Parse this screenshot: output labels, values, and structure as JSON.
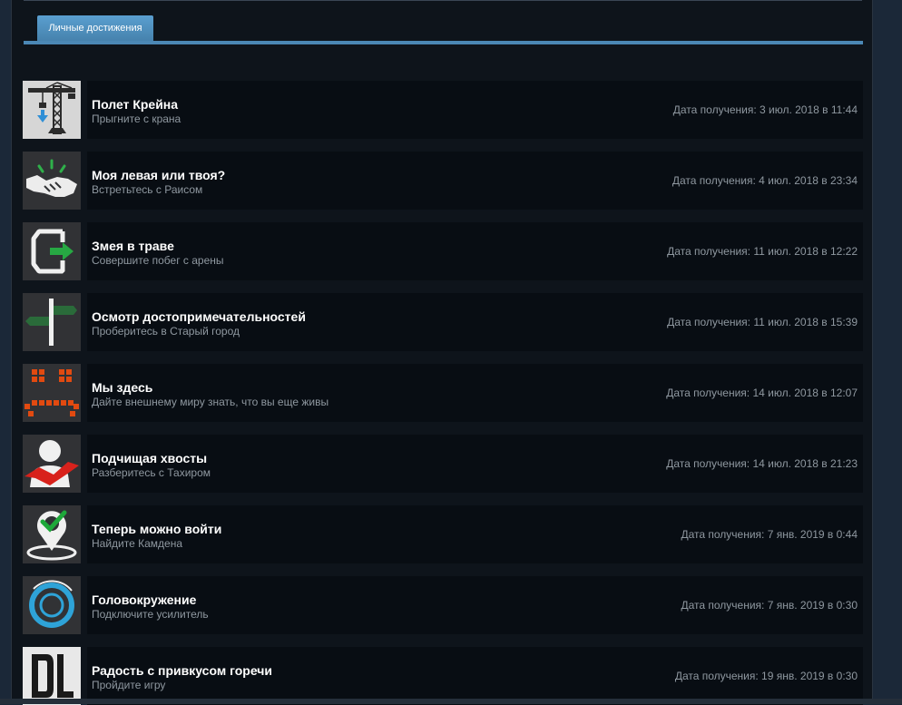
{
  "tabs": [
    {
      "label": "Личные достижения",
      "active": true
    }
  ],
  "achievements": [
    {
      "title": "Полет Крейна",
      "description": "Прыгните с крана",
      "date": "Дата получения: 3 июл. 2018 в 11:44",
      "icon": "crane-icon"
    },
    {
      "title": "Моя левая или твоя?",
      "description": "Встретьтесь с Раисом",
      "date": "Дата получения: 4 июл. 2018 в 23:34",
      "icon": "handshake-icon"
    },
    {
      "title": "Змея в траве",
      "description": "Совершите побег с арены",
      "date": "Дата получения: 11 июл. 2018 в 12:22",
      "icon": "exit-icon"
    },
    {
      "title": "Осмотр достопримечательностей",
      "description": "Проберитесь в Старый город",
      "date": "Дата получения: 11 июл. 2018 в 15:39",
      "icon": "signpost-icon"
    },
    {
      "title": "Мы здесь",
      "description": "Дайте внешнему миру знать, что вы еще живы",
      "date": "Дата получения: 14 июл. 2018 в 12:07",
      "icon": "pixel-face-icon"
    },
    {
      "title": "Подчищая хвосты",
      "description": "Разберитесь с Тахиром",
      "date": "Дата получения: 14 июл. 2018 в 21:23",
      "icon": "person-icon"
    },
    {
      "title": "Теперь можно войти",
      "description": "Найдите Камдена",
      "date": "Дата получения: 7 янв. 2019 в 0:44",
      "icon": "location-check-icon"
    },
    {
      "title": "Головокружение",
      "description": "Подключите усилитель",
      "date": "Дата получения: 7 янв. 2019 в 0:30",
      "icon": "ring-icon"
    },
    {
      "title": "Радость с привкусом горечи",
      "description": "Пройдите игру",
      "date": "Дата получения: 19 янв. 2019 в 0:30",
      "icon": "dl-logo-icon"
    }
  ],
  "colors": {
    "tab": "#4b88b5",
    "card": "#080d13",
    "title": "#ffffff",
    "muted": "#8f98a0"
  }
}
